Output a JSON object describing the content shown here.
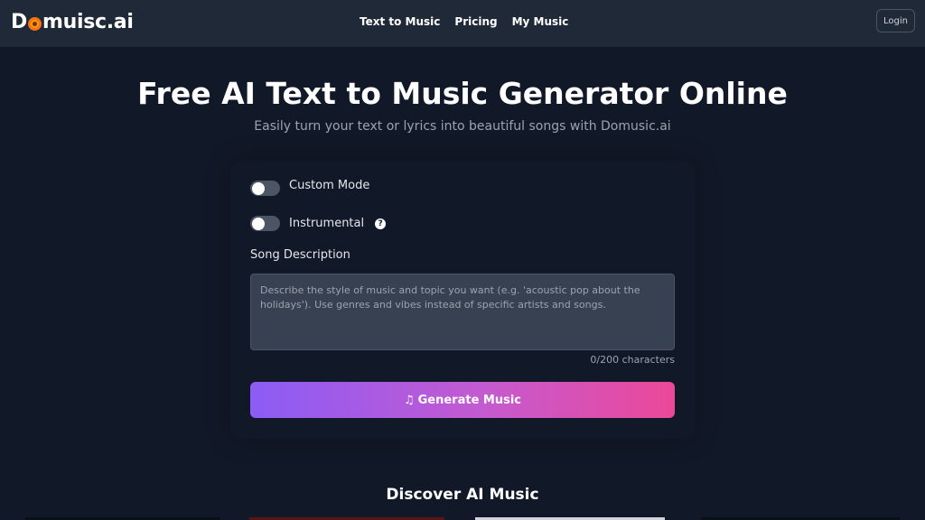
{
  "header": {
    "logo_text_before": "D",
    "logo_text_after": "muisc.ai",
    "nav": [
      "Text to Music",
      "Pricing",
      "My Music"
    ],
    "login_label": "Login"
  },
  "hero": {
    "title": "Free AI Text to Music Generator Online",
    "subtitle": "Easily turn your text or lyrics into beautiful songs with Domusic.ai"
  },
  "form": {
    "custom_mode_label": "Custom Mode",
    "custom_mode_on": false,
    "instrumental_label": "Instrumental",
    "instrumental_on": false,
    "help_icon": "question-circle-icon",
    "song_description_label": "Song Description",
    "song_description_value": "",
    "song_description_placeholder": "Describe the style of music and topic you want (e.g. 'acoustic pop about the holidays'). Use genres and vibes instead of specific artists and songs.",
    "char_count": "0/200 characters",
    "generate_icon": "music-note-icon",
    "generate_label": "Generate Music"
  },
  "discover": {
    "title": "Discover AI Music"
  },
  "colors": {
    "background": "#111827",
    "header_bg": "#1f2937",
    "gradient_start": "#8b5cf6",
    "gradient_end": "#ec4899"
  }
}
